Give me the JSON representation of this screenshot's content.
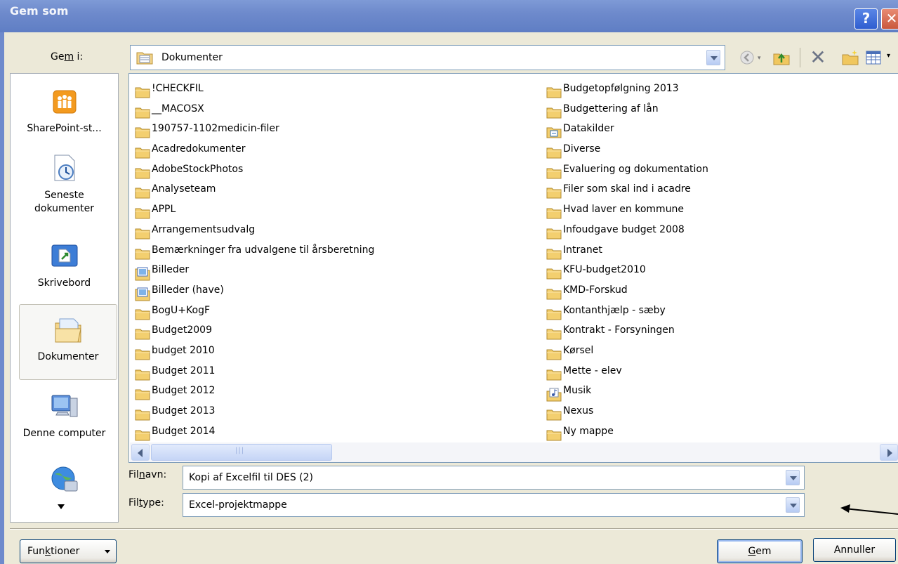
{
  "window": {
    "title": "Gem som",
    "help_glyph": "?",
    "close_glyph": "✕"
  },
  "location": {
    "label_pre": "Ge",
    "label_accel": "m",
    "label_post": " i:",
    "value": "Dokumenter"
  },
  "places": [
    {
      "label": "SharePoint-st...",
      "icon": "sharepoint-icon"
    },
    {
      "label": "Seneste dokumenter",
      "icon": "recent-documents-icon"
    },
    {
      "label": "Skrivebord",
      "icon": "desktop-icon"
    },
    {
      "label": "Dokumenter",
      "icon": "documents-folder-icon"
    },
    {
      "label": "Denne computer",
      "icon": "my-computer-icon"
    },
    {
      "label": "",
      "icon": "network-icon"
    }
  ],
  "files_col1": [
    {
      "name": "!CHECKFIL",
      "icon": "folder"
    },
    {
      "name": "__MACOSX",
      "icon": "folder"
    },
    {
      "name": "190757-1102medicin-filer",
      "icon": "folder"
    },
    {
      "name": "Acadredokumenter",
      "icon": "folder"
    },
    {
      "name": "AdobeStockPhotos",
      "icon": "folder"
    },
    {
      "name": "Analyseteam",
      "icon": "folder"
    },
    {
      "name": "APPL",
      "icon": "folder"
    },
    {
      "name": "Arrangementsudvalg",
      "icon": "folder"
    },
    {
      "name": "Bemærkninger fra udvalgene til årsberetning",
      "icon": "folder"
    },
    {
      "name": "Billeder",
      "icon": "pictures"
    },
    {
      "name": "Billeder (have)",
      "icon": "pictures"
    },
    {
      "name": "BogU+KogF",
      "icon": "folder"
    },
    {
      "name": "Budget2009",
      "icon": "folder"
    },
    {
      "name": "budget 2010",
      "icon": "folder"
    },
    {
      "name": "Budget 2011",
      "icon": "folder"
    },
    {
      "name": "Budget 2012",
      "icon": "folder"
    },
    {
      "name": "Budget 2013",
      "icon": "folder"
    },
    {
      "name": "Budget 2014",
      "icon": "folder"
    }
  ],
  "files_col2": [
    {
      "name": "Budgetopfølgning 2013",
      "icon": "folder"
    },
    {
      "name": "Budgettering af lån",
      "icon": "folder"
    },
    {
      "name": "Datakilder",
      "icon": "datasource"
    },
    {
      "name": "Diverse",
      "icon": "folder"
    },
    {
      "name": "Evaluering og dokumentation",
      "icon": "folder"
    },
    {
      "name": "Filer som skal ind i acadre",
      "icon": "folder"
    },
    {
      "name": "Hvad laver en kommune",
      "icon": "folder"
    },
    {
      "name": "Infoudgave budget 2008",
      "icon": "folder"
    },
    {
      "name": "Intranet",
      "icon": "folder"
    },
    {
      "name": "KFU-budget2010",
      "icon": "folder"
    },
    {
      "name": "KMD-Forskud",
      "icon": "folder"
    },
    {
      "name": "Kontanthjælp - sæby",
      "icon": "folder"
    },
    {
      "name": "Kontrakt - Forsyningen",
      "icon": "folder"
    },
    {
      "name": "Kørsel",
      "icon": "folder"
    },
    {
      "name": "Mette - elev",
      "icon": "folder"
    },
    {
      "name": "Musik",
      "icon": "music"
    },
    {
      "name": "Nexus",
      "icon": "folder"
    },
    {
      "name": "Ny mappe",
      "icon": "folder"
    }
  ],
  "filename": {
    "label_pre": "Fil",
    "label_accel": "n",
    "label_post": "avn:",
    "value": "Kopi af Excelfil til DES (2)"
  },
  "filetype": {
    "label_pre": "Fil",
    "label_accel": "t",
    "label_post": "ype:",
    "value": "Excel-projektmappe"
  },
  "buttons": {
    "tools_pre": "Fun",
    "tools_accel": "k",
    "tools_post": "tioner",
    "save_accel": "G",
    "save_post": "em",
    "cancel": "Annuller"
  },
  "scroll_glyph": "|||"
}
